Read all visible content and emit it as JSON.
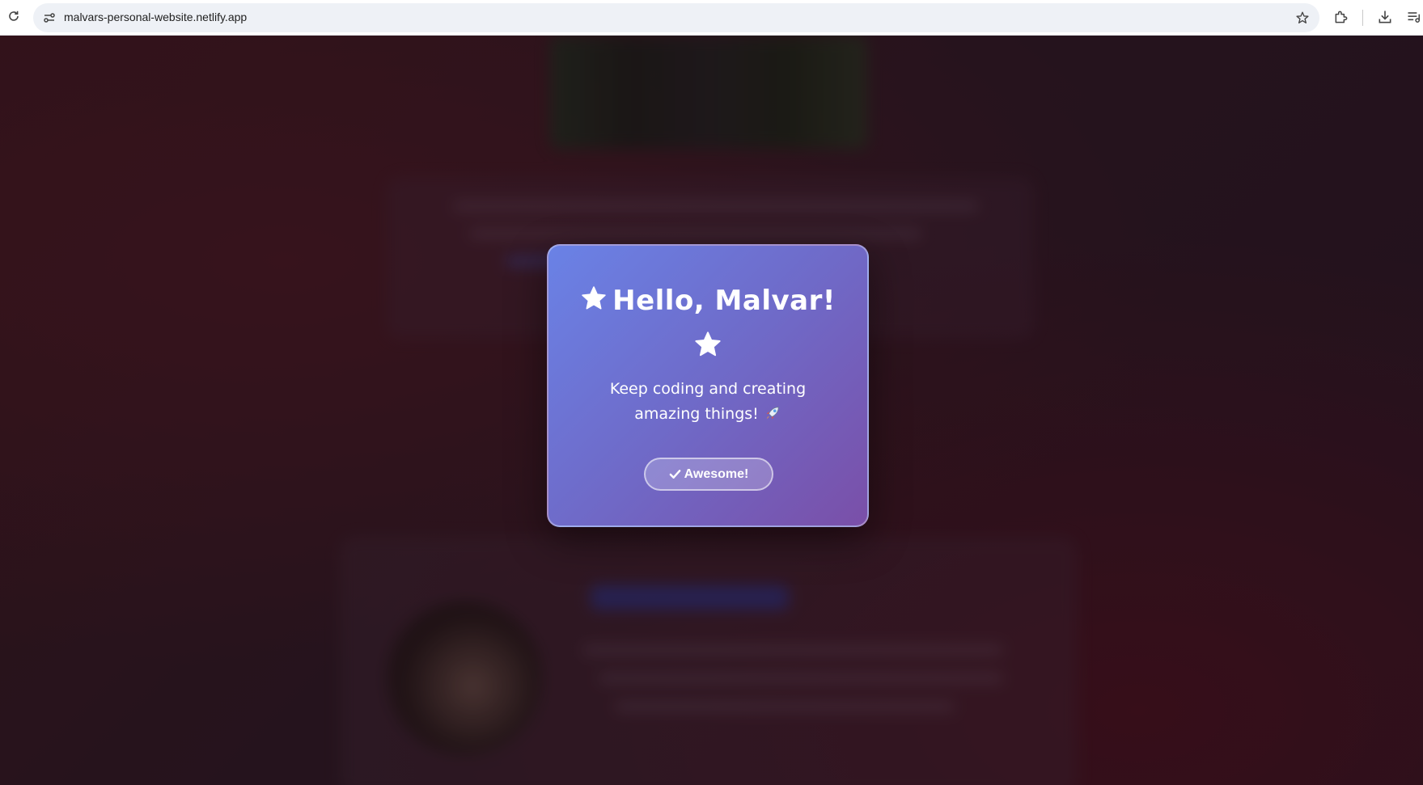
{
  "browser": {
    "url": "malvars-personal-website.netlify.app"
  },
  "modal": {
    "title": "Hello, Malvar!",
    "message": "Keep coding and creating amazing things!",
    "button_label": "Awesome!",
    "icons": {
      "title_icon": "star-icon",
      "below_title_icon": "star-icon",
      "message_icon": "rocket-icon",
      "button_icon": "check-icon"
    },
    "colors": {
      "gradient_start": "#6a82e6",
      "gradient_end": "#7a4fa8"
    }
  }
}
